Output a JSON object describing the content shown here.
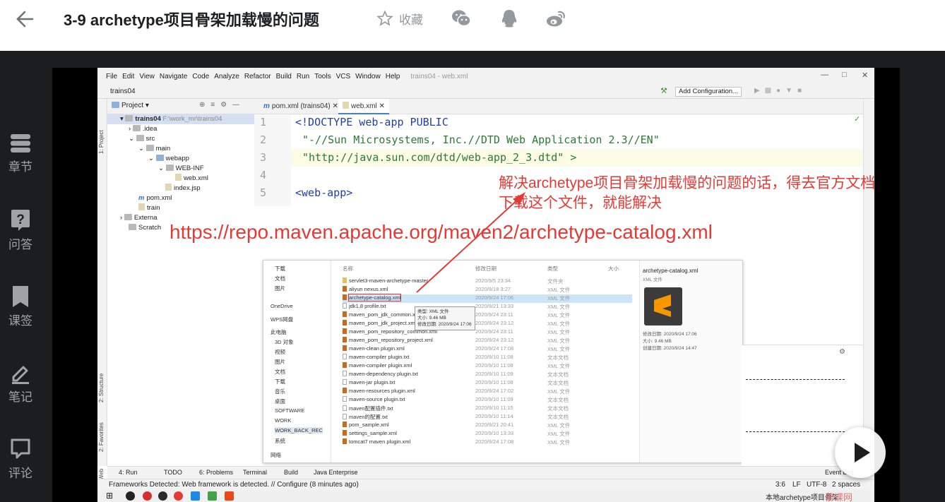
{
  "header": {
    "title": "3-9 archetype项目骨架加载慢的问题",
    "favorite_label": "收藏"
  },
  "sidebar": {
    "items": [
      {
        "label": "章节",
        "icon": "chapters-icon"
      },
      {
        "label": "问答",
        "icon": "question-icon"
      },
      {
        "label": "课签",
        "icon": "bookmark-icon"
      },
      {
        "label": "笔记",
        "icon": "pen-icon"
      },
      {
        "label": "评论",
        "icon": "comment-icon"
      }
    ]
  },
  "ide": {
    "menu": [
      "File",
      "Edit",
      "View",
      "Navigate",
      "Code",
      "Analyze",
      "Refactor",
      "Build",
      "Run",
      "Tools",
      "VCS",
      "Window",
      "Help"
    ],
    "window_title": "trains04 - web.xml",
    "project_name": "trains04",
    "add_configuration": "Add Configuration...",
    "project_label": "Project",
    "tree": [
      {
        "label": "trains04",
        "extra": "F:\\work_mr\\trains04"
      },
      {
        "label": ".idea"
      },
      {
        "label": "src"
      },
      {
        "label": "main"
      },
      {
        "label": "webapp"
      },
      {
        "label": "WEB-INF"
      },
      {
        "label": "web.xml"
      },
      {
        "label": "index.jsp"
      },
      {
        "label": "pom.xml"
      },
      {
        "label": "train"
      },
      {
        "label": "Externa"
      },
      {
        "label": "Scratch"
      }
    ],
    "tabs": [
      {
        "label": "pom.xml (trains04)"
      },
      {
        "label": "web.xml"
      }
    ],
    "line_numbers": [
      "1",
      "2",
      "3",
      "4",
      "5"
    ],
    "code": [
      "<!DOCTYPE web-app PUBLIC",
      "\"-//Sun Microsystems, Inc.//DTD Web Application 2.3//EN\"",
      "\"http://java.sun.com/dtd/web-app_2_3.dtd\" >",
      "",
      "<web-app>"
    ],
    "tool_windows": [
      "4: Run",
      "TODO",
      "6: Problems",
      "Terminal",
      "Build",
      "Java Enterprise"
    ],
    "event_log": "Event Log",
    "status_message": "Frameworks Detected: Web framework is detected. // Configure (8 minutes ago)",
    "status_right": [
      "3:6",
      "LF",
      "UTF-8",
      "2 spaces"
    ],
    "side_labels": [
      "1: Project",
      "2: Structure",
      "2: Favorites",
      "Web"
    ]
  },
  "annotation": {
    "note_line1": "解决archetype项目骨架加载慢的问题的话，得去官方文档",
    "note_line2": "下载这个文件，就能解决",
    "url": "https://repo.maven.apache.org/maven2/archetype-catalog.xml"
  },
  "explorer": {
    "nav": [
      "下载",
      "文档",
      "图片",
      "OneDrive",
      "WPS网盘",
      "此电脑",
      "3D 对象",
      "视频",
      "图片",
      "文档",
      "下载",
      "音乐",
      "桌面",
      "SOFTWARE",
      "WORK",
      "WORK_BACK_REC",
      "系统",
      "网络"
    ],
    "headers": [
      "名称",
      "修改日期",
      "类型",
      "大小"
    ],
    "files": [
      {
        "name": "servlet3-maven-archetype-master",
        "date": "2020/9/5 23:34",
        "type": "文件夹"
      },
      {
        "name": "aliyun nexus.xml",
        "date": "2020/9/18 3:27",
        "type": "XML 文件"
      },
      {
        "name": "archetype-catalog.xml",
        "date": "2020/9/24 17:06",
        "type": "XML 文件"
      },
      {
        "name": "jdk1.8 profile.txt",
        "date": "2020/9/21 13:33",
        "type": "XML 文件"
      },
      {
        "name": "maven_pom_jdk_common.xml",
        "date": "2020/9/24 23:11",
        "type": "XML 文件"
      },
      {
        "name": "maven_pom_jdk_project.xml",
        "date": "2020/9/24 23:12",
        "type": "XML 文件"
      },
      {
        "name": "maven_pom_repository_common.xml",
        "date": "2020/9/24 23:11",
        "type": "XML 文件"
      },
      {
        "name": "maven_pom_repository_project.xml",
        "date": "2020/9/24 23:12",
        "type": "XML 文件"
      },
      {
        "name": "maven-clean plugin.xml",
        "date": "2020/9/24 17:08",
        "type": "XML 文件"
      },
      {
        "name": "maven-compiler plugin.txt",
        "date": "2020/9/10 11:08",
        "type": "文本文档"
      },
      {
        "name": "maven-compiler plugin.xml",
        "date": "2020/9/10 11:08",
        "type": "XML 文件"
      },
      {
        "name": "maven-dependency plugin.txt",
        "date": "2020/9/10 11:09",
        "type": "文本文档"
      },
      {
        "name": "maven-jar plugin.txt",
        "date": "2020/9/10 11:08",
        "type": "文本文档"
      },
      {
        "name": "maven-resources plugin.xml",
        "date": "2020/9/24 17:02",
        "type": "XML 文件"
      },
      {
        "name": "maven-source plugin.txt",
        "date": "2020/9/10 11:09",
        "type": "文本文档"
      },
      {
        "name": "maven配置插件.txt",
        "date": "2020/9/10 11:15",
        "type": "文本文档"
      },
      {
        "name": "maven的配置.txt",
        "date": "2020/9/10 11:14",
        "type": "文本文档"
      },
      {
        "name": "pom_sample.xml",
        "date": "2020/9/21 20:41",
        "type": "XML 文件"
      },
      {
        "name": "settings_sample.xml",
        "date": "2020/9/10 13:33",
        "type": "XML 文件"
      },
      {
        "name": "tomcat7 maven plugin.xml",
        "date": "2020/9/24 17:08",
        "type": "XML 文件"
      }
    ],
    "tooltip": [
      "类型: XML 文件",
      "大小: 9.46 MB",
      "修改日期: 2020/9/24 17:06"
    ],
    "preview_name": "archetype-catalog.xml",
    "preview_type": "XML 文件",
    "preview_meta": [
      "修改日期: 2020/9/24 17:06",
      "大小: 9.46 MB",
      "创建日期: 2020/9/24 14:47"
    ]
  },
  "taskbar": {
    "right_text": "本地archetype项目骨架",
    "watermark": "慕课网"
  }
}
